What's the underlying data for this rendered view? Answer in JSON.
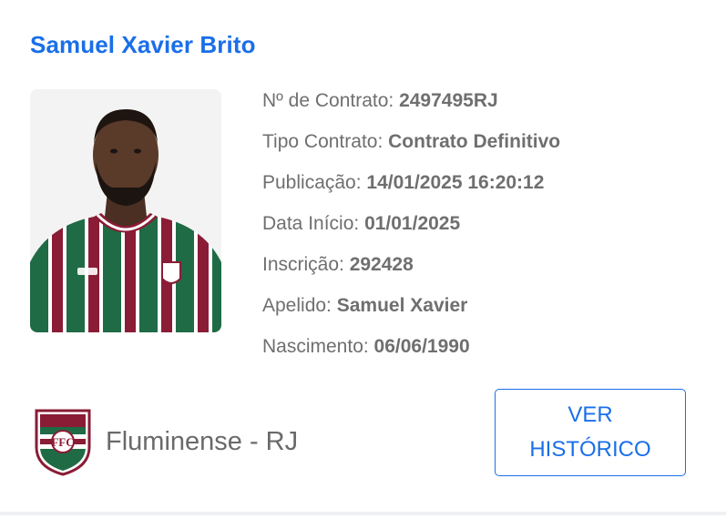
{
  "player": {
    "name": "Samuel Xavier Brito"
  },
  "contract": {
    "number_label": "Nº de Contrato: ",
    "number_value": "2497495RJ",
    "type_label": "Tipo Contrato: ",
    "type_value": "Contrato Definitivo",
    "publication_label": "Publicação: ",
    "publication_value": "14/01/2025 16:20:12",
    "start_label": "Data Início: ",
    "start_value": "01/01/2025",
    "registration_label": "Inscrição: ",
    "registration_value": "292428",
    "nickname_label": "Apelido: ",
    "nickname_value": "Samuel Xavier",
    "birth_label": "Nascimento: ",
    "birth_value": "06/06/1990"
  },
  "club": {
    "name": "Fluminense - RJ",
    "crest_letters": "FFC"
  },
  "actions": {
    "history_label": "VER HISTÓRICO"
  },
  "colors": {
    "accent": "#1a6fe8",
    "text_muted": "#6f6f6f",
    "fluminense_green": "#1f6b45",
    "fluminense_maroon": "#8a1c35"
  }
}
